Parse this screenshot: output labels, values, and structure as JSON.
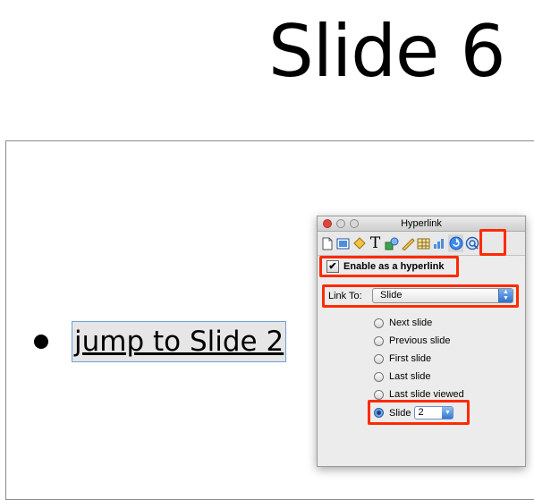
{
  "slide": {
    "title": "Slide 6",
    "bullet_text": "jump to Slide 2"
  },
  "inspector": {
    "window_title": "Hyperlink",
    "toolbar_icons": [
      "document-icon",
      "slide-icon",
      "transition-icon",
      "text-icon",
      "shapes-icon",
      "ruler-icon",
      "table-icon",
      "chart-icon",
      "hyperlink-icon",
      "quicktime-icon"
    ],
    "enable_label": "Enable as a hyperlink",
    "enable_checked": true,
    "link_to_label": "Link To:",
    "link_to_value": "Slide",
    "options": [
      {
        "label": "Next slide",
        "checked": false
      },
      {
        "label": "Previous slide",
        "checked": false
      },
      {
        "label": "First slide",
        "checked": false
      },
      {
        "label": "Last slide",
        "checked": false
      },
      {
        "label": "Last slide viewed",
        "checked": false
      },
      {
        "label": "Slide",
        "checked": true
      }
    ],
    "slide_number": "2"
  },
  "colors": {
    "highlight": "#ff2a00",
    "accent": "#3f7fd5"
  }
}
